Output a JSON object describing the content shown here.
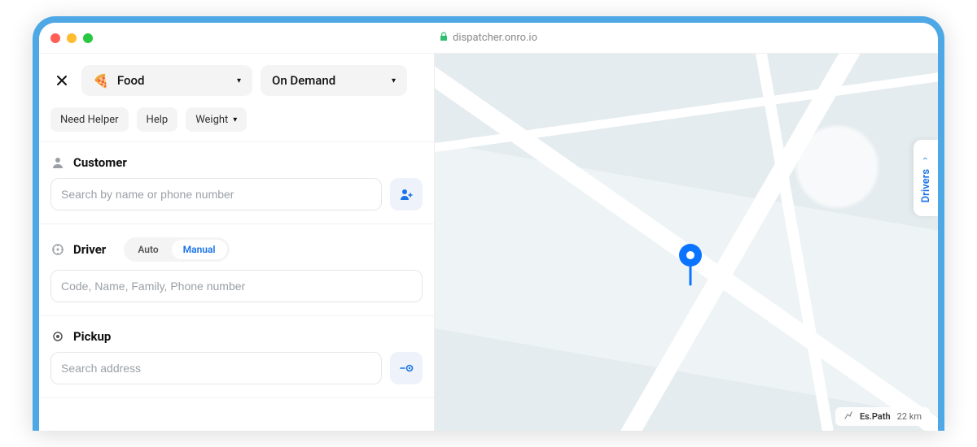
{
  "browser": {
    "url": "dispatcher.onro.io"
  },
  "topbar": {
    "category": {
      "emoji": "🍕",
      "label": "Food"
    },
    "dispatch": {
      "label": "On Demand"
    },
    "chips": {
      "needHelper": "Need Helper",
      "help": "Help",
      "weight": "Weight"
    }
  },
  "customer": {
    "title": "Customer",
    "placeholder": "Search by name or phone number"
  },
  "driver": {
    "title": "Driver",
    "auto": "Auto",
    "manual": "Manual",
    "placeholder": "Code, Name, Family, Phone number"
  },
  "pickup": {
    "title": "Pickup",
    "placeholder": "Search address"
  },
  "map": {
    "driversTab": "Drivers",
    "estPathLabel": "Es.Path",
    "estPathValue": "22 km"
  }
}
